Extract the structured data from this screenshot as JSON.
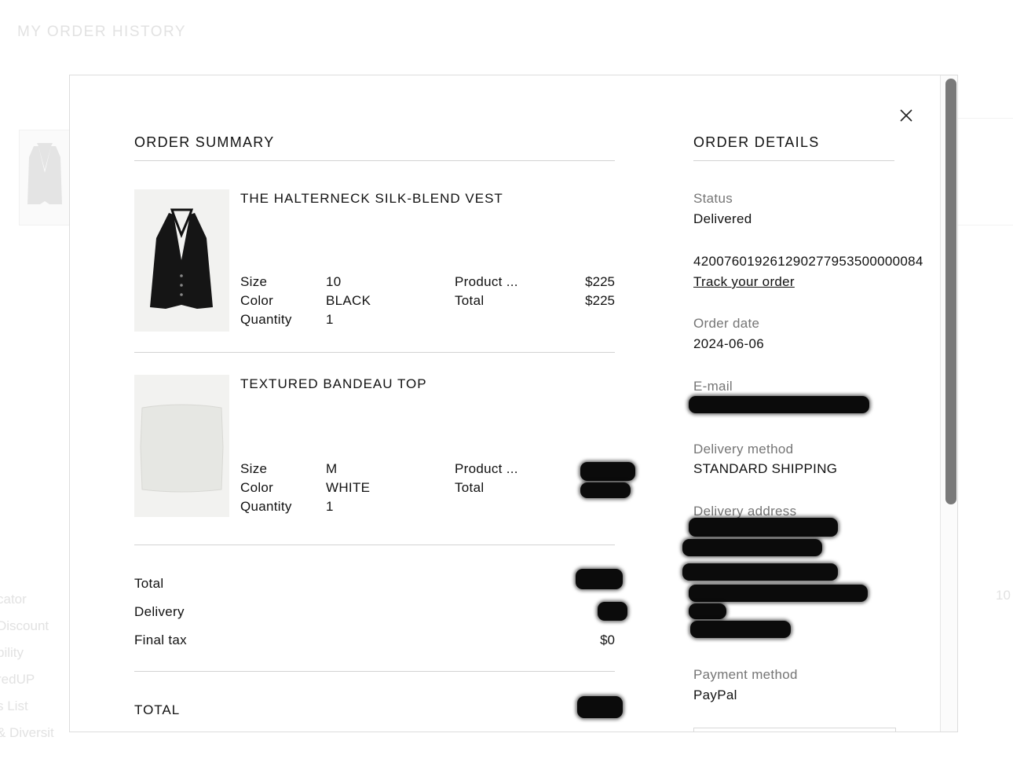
{
  "background": {
    "page_title": "MY ORDER HISTORY",
    "side_links": [
      "cator",
      "Discount",
      "bility",
      "redUP",
      "s List",
      "& Diversit"
    ],
    "right_number": "10"
  },
  "order_summary": {
    "title": "ORDER SUMMARY",
    "products": [
      {
        "name": "THE HALTERNECK SILK-BLEND VEST",
        "image_icon": "halterneck-vest-image",
        "size_label": "Size",
        "size": "10",
        "color_label": "Color",
        "color": "BLACK",
        "quantity_label": "Quantity",
        "quantity": "1",
        "product_price_label": "Product ...",
        "product_price": "$225",
        "total_label": "Total",
        "total": "$225"
      },
      {
        "name": "TEXTURED BANDEAU TOP",
        "image_icon": "bandeau-top-image",
        "size_label": "Size",
        "size": "M",
        "color_label": "Color",
        "color": "WHITE",
        "quantity_label": "Quantity",
        "quantity": "1",
        "product_price_label": "Product ...",
        "product_price": "",
        "total_label": "Total",
        "total": ""
      }
    ],
    "totals": {
      "total_label": "Total",
      "total_value": "",
      "delivery_label": "Delivery",
      "delivery_value": "",
      "final_tax_label": "Final tax",
      "final_tax_value": "$0",
      "grand_total_label": "TOTAL",
      "grand_total_value": ""
    }
  },
  "order_details": {
    "title": "ORDER DETAILS",
    "status_label": "Status",
    "status_value": "Delivered",
    "tracking_number": "420076019261290277953500000084",
    "track_link": "Track your order",
    "order_date_label": "Order date",
    "order_date_value": "2024-06-06",
    "email_label": "E-mail",
    "delivery_method_label": "Delivery method",
    "delivery_method_value": "STANDARD SHIPPING",
    "delivery_address_label": "Delivery address",
    "payment_method_label": "Payment method",
    "payment_method_value": "PayPal"
  },
  "colors": {
    "text": "#111111",
    "muted": "#757575",
    "divider": "#d3d3d3",
    "scrollbar": "#7a7a7a",
    "redaction": "#0b0b0b"
  },
  "icons": {
    "close": "close-icon"
  }
}
